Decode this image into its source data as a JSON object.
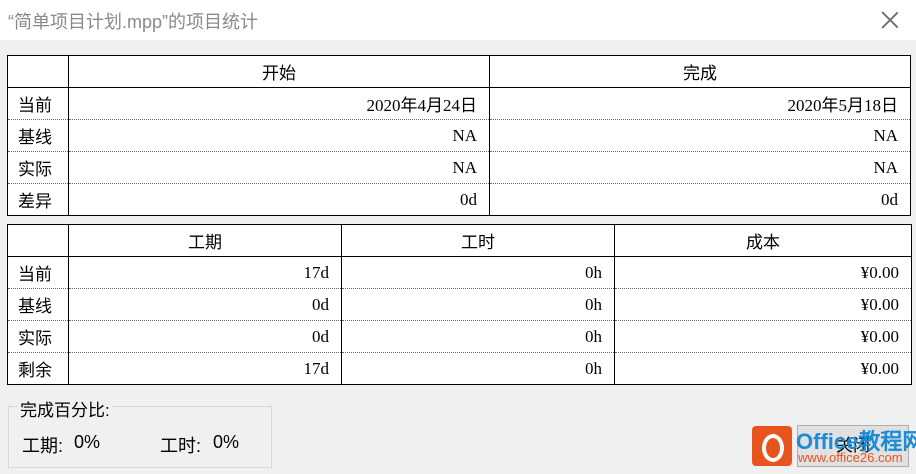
{
  "window": {
    "title": "“简单项目计划.mpp”的项目统计"
  },
  "dates_table": {
    "headers": [
      "开始",
      "完成"
    ],
    "rows": [
      {
        "label": "当前",
        "start": "2020年4月24日",
        "finish": "2020年5月18日"
      },
      {
        "label": "基线",
        "start": "NA",
        "finish": "NA"
      },
      {
        "label": "实际",
        "start": "NA",
        "finish": "NA"
      },
      {
        "label": "差异",
        "start": "0d",
        "finish": "0d"
      }
    ]
  },
  "work_table": {
    "headers": [
      "工期",
      "工时",
      "成本"
    ],
    "rows": [
      {
        "label": "当前",
        "duration": "17d",
        "work": "0h",
        "cost": "¥0.00"
      },
      {
        "label": "基线",
        "duration": "0d",
        "work": "0h",
        "cost": "¥0.00"
      },
      {
        "label": "实际",
        "duration": "0d",
        "work": "0h",
        "cost": "¥0.00"
      },
      {
        "label": "剩余",
        "duration": "17d",
        "work": "0h",
        "cost": "¥0.00"
      }
    ]
  },
  "percent_complete": {
    "label": "完成百分比:",
    "duration_label": "工期:",
    "duration_value": "0%",
    "work_label": "工时:",
    "work_value": "0%"
  },
  "buttons": {
    "close_label": "关闭"
  },
  "watermark": {
    "line1": "Office教程网",
    "line2": "www.office26.com"
  }
}
